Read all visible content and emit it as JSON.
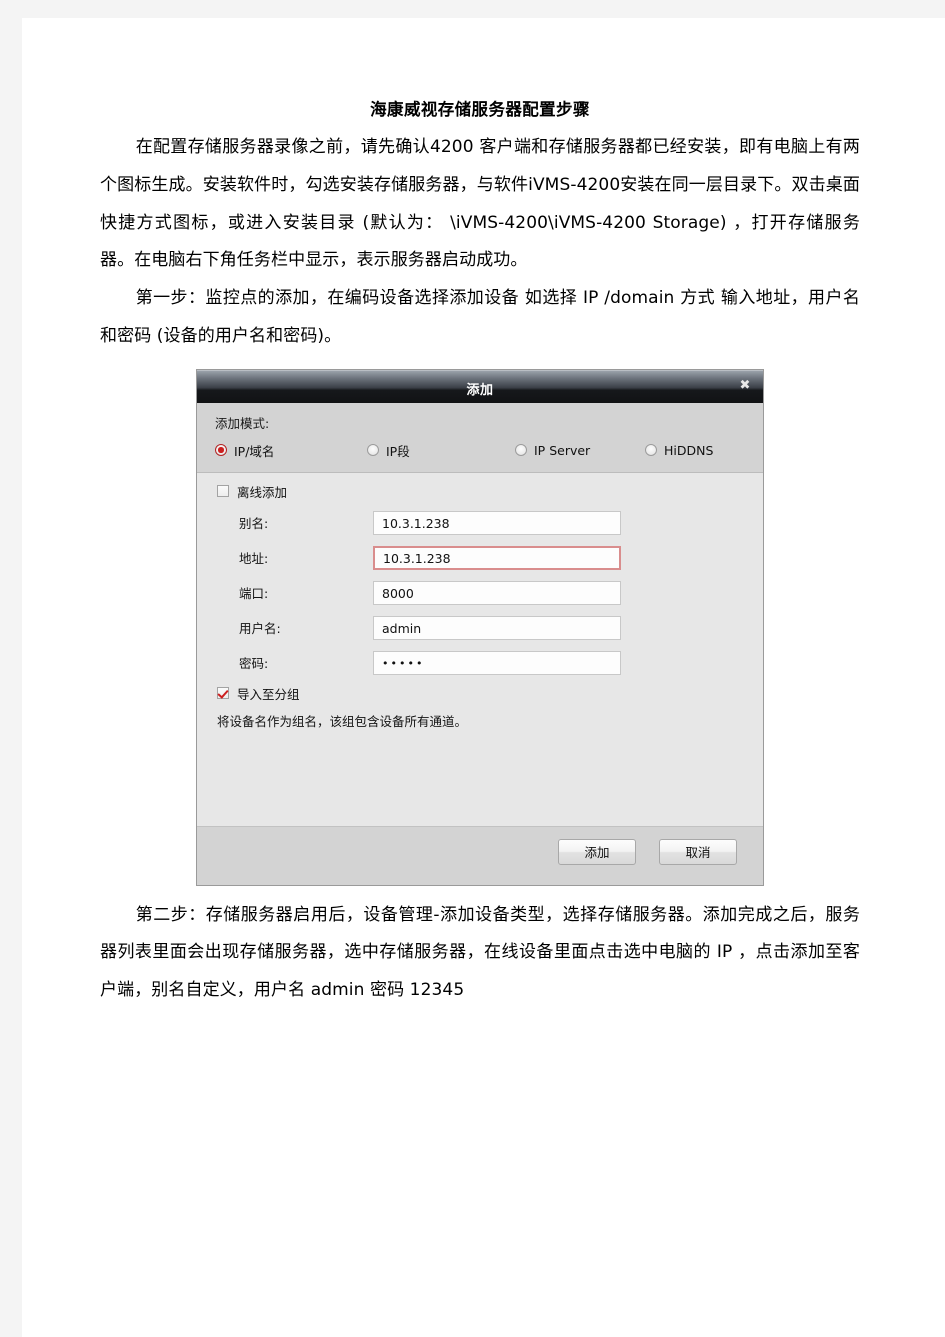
{
  "document": {
    "title": "海康威视存储服务器配置步骤",
    "paragraphs": {
      "p1": "在配置存储服务器录像之前，请先确认4200  客户端和存储服务器都已经安装，即有电脑上有两个图标生成。安装软件时，勾选安装存储服务器，与软件iVMS-4200安装在同一层目录下。双击桌面快捷方式图标，或进入安装目录 (默认为： \\iVMS-4200\\iVMS-4200 Storage) ，打开存储服务器。在电脑右下角任务栏中显示，表示服务器启动成功。",
      "p2": "第一步：监控点的添加，在编码设备选择添加设备 如选择 IP  /domain 方式 输入地址，用户名和密码 (设备的用户名和密码)。",
      "p3": "第二步：存储服务器启用后，设备管理-添加设备类型，选择存储服务器。添加完成之后，服务器列表里面会出现存储服务器，选中存储服务器，在线设备里面点击选中电脑的 IP  ，点击添加至客户端，别名自定义，用户名 admin   密码 12345"
    }
  },
  "dialog": {
    "title": "添加",
    "close_label": "✖",
    "mode_label": "添加模式:",
    "modes": [
      {
        "label": "IP/域名",
        "checked": true
      },
      {
        "label": "IP段",
        "checked": false
      },
      {
        "label": "IP Server",
        "checked": false
      },
      {
        "label": "HiDDNS",
        "checked": false
      }
    ],
    "offline_add": {
      "label": "离线添加",
      "checked": false
    },
    "fields": [
      {
        "label": "别名:",
        "value": "10.3.1.238",
        "focused": false,
        "masked": false
      },
      {
        "label": "地址:",
        "value": "10.3.1.238",
        "focused": true,
        "masked": false
      },
      {
        "label": "端口:",
        "value": "8000",
        "focused": false,
        "masked": false
      },
      {
        "label": "用户名:",
        "value": "admin",
        "focused": false,
        "masked": false
      },
      {
        "label": "密码:",
        "value": "•••••",
        "focused": false,
        "masked": true
      }
    ],
    "import_group": {
      "label": "导入至分组",
      "checked": true
    },
    "hint": "将设备名作为组名，该组包含设备所有通道。",
    "buttons": {
      "add": "添加",
      "cancel": "取消"
    },
    "colors": {
      "accent_red": "#cc1f1f",
      "focus_border": "#d98d8d",
      "titlebar_dark": "#16181b",
      "panel_gray": "#d3d3d3",
      "form_gray": "#e7e7e7"
    }
  }
}
